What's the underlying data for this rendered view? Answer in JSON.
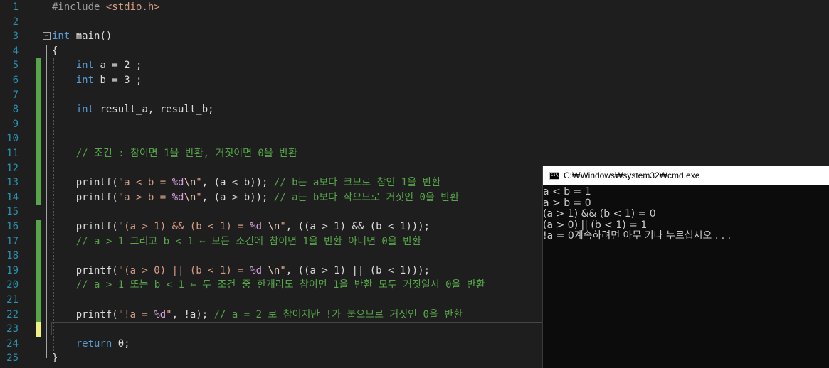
{
  "editor": {
    "lines": [
      {
        "num": "1",
        "tokens": [
          [
            "pp",
            "#include "
          ],
          [
            "inc",
            "<stdio.h>"
          ]
        ]
      },
      {
        "num": "2",
        "tokens": []
      },
      {
        "num": "3",
        "tokens": [
          [
            "kw",
            "int"
          ],
          [
            "plain",
            " main()"
          ]
        ]
      },
      {
        "num": "4",
        "tokens": [
          [
            "plain",
            "{"
          ]
        ]
      },
      {
        "num": "5",
        "tokens": [
          [
            "plain",
            "    "
          ],
          [
            "kw",
            "int"
          ],
          [
            "plain",
            " a = 2 ;"
          ]
        ]
      },
      {
        "num": "6",
        "tokens": [
          [
            "plain",
            "    "
          ],
          [
            "kw",
            "int"
          ],
          [
            "plain",
            " b = 3 ;"
          ]
        ]
      },
      {
        "num": "7",
        "tokens": []
      },
      {
        "num": "8",
        "tokens": [
          [
            "plain",
            "    "
          ],
          [
            "kw",
            "int"
          ],
          [
            "plain",
            " result_a, result_b;"
          ]
        ]
      },
      {
        "num": "9",
        "tokens": []
      },
      {
        "num": "10",
        "tokens": []
      },
      {
        "num": "11",
        "tokens": [
          [
            "plain",
            "    "
          ],
          [
            "cmt",
            "// 조건 : 참이면 1을 반환, 거짓이면 0을 반환"
          ]
        ]
      },
      {
        "num": "12",
        "tokens": []
      },
      {
        "num": "13",
        "tokens": [
          [
            "plain",
            "    printf("
          ],
          [
            "str",
            "\"a < b = "
          ],
          [
            "fmt",
            "%d"
          ],
          [
            "esc",
            "\\n"
          ],
          [
            "str",
            "\""
          ],
          [
            "plain",
            ", (a < b)); "
          ],
          [
            "cmt",
            "// b는 a보다 크므로 참인 1을 반환"
          ]
        ]
      },
      {
        "num": "14",
        "tokens": [
          [
            "plain",
            "    printf("
          ],
          [
            "str",
            "\"a > b = "
          ],
          [
            "fmt",
            "%d"
          ],
          [
            "esc",
            "\\n"
          ],
          [
            "str",
            "\""
          ],
          [
            "plain",
            ", (a > b)); "
          ],
          [
            "cmt",
            "// a는 b보다 작으므로 거짓인 0을 반환"
          ]
        ]
      },
      {
        "num": "15",
        "tokens": []
      },
      {
        "num": "16",
        "tokens": [
          [
            "plain",
            "    printf("
          ],
          [
            "str",
            "\"(a > 1) && (b < 1) = "
          ],
          [
            "fmt",
            "%d"
          ],
          [
            "str",
            " "
          ],
          [
            "esc",
            "\\n"
          ],
          [
            "str",
            "\""
          ],
          [
            "plain",
            ", ((a > 1) && (b < 1)));"
          ]
        ]
      },
      {
        "num": "17",
        "tokens": [
          [
            "plain",
            "    "
          ],
          [
            "cmt",
            "// a > 1 그리고 b < 1 ← 모든 조건에 참이면 1을 반환 아니면 0을 반환"
          ]
        ]
      },
      {
        "num": "18",
        "tokens": []
      },
      {
        "num": "19",
        "tokens": [
          [
            "plain",
            "    printf("
          ],
          [
            "str",
            "\"(a > 0) || (b < 1) = "
          ],
          [
            "fmt",
            "%d"
          ],
          [
            "str",
            " "
          ],
          [
            "esc",
            "\\n"
          ],
          [
            "str",
            "\""
          ],
          [
            "plain",
            ", ((a > 1) || (b < 1)));"
          ]
        ]
      },
      {
        "num": "20",
        "tokens": [
          [
            "plain",
            "    "
          ],
          [
            "cmt",
            "// a > 1 또는 b < 1 ← 두 조건 중 한개라도 참이면 1을 반환 모두 거짓일시 0을 반환"
          ]
        ]
      },
      {
        "num": "21",
        "tokens": []
      },
      {
        "num": "22",
        "tokens": [
          [
            "plain",
            "    printf("
          ],
          [
            "str",
            "\"!a = "
          ],
          [
            "fmt",
            "%d"
          ],
          [
            "str",
            "\""
          ],
          [
            "plain",
            ", !a); "
          ],
          [
            "cmt",
            "// a = 2 로 참이지만 !가 붙으므로 거짓인 0을 반환"
          ]
        ]
      },
      {
        "num": "23",
        "tokens": []
      },
      {
        "num": "24",
        "tokens": [
          [
            "plain",
            "    "
          ],
          [
            "kw",
            "return"
          ],
          [
            "plain",
            " 0;"
          ]
        ]
      },
      {
        "num": "25",
        "tokens": [
          [
            "plain",
            "}"
          ]
        ]
      }
    ],
    "fold_glyph": "−"
  },
  "colors": {
    "editor_bg": "#1e1e1e",
    "line_number": "#2b91af",
    "keyword": "#569cd6",
    "string": "#d69d85",
    "comment": "#57a64a",
    "change_bar_saved": "#57a64a",
    "change_bar_unsaved": "#eff283"
  },
  "console": {
    "title": "C:₩Windows₩system32₩cmd.exe",
    "icon_label": "C:\\",
    "output": [
      "a < b = 1",
      "a > b = 0",
      "(a > 1) && (b < 1) = 0",
      "(a > 0) || (b < 1) = 1",
      "!a = 0계속하려면 아무 키나 누르십시오 . . ."
    ]
  }
}
